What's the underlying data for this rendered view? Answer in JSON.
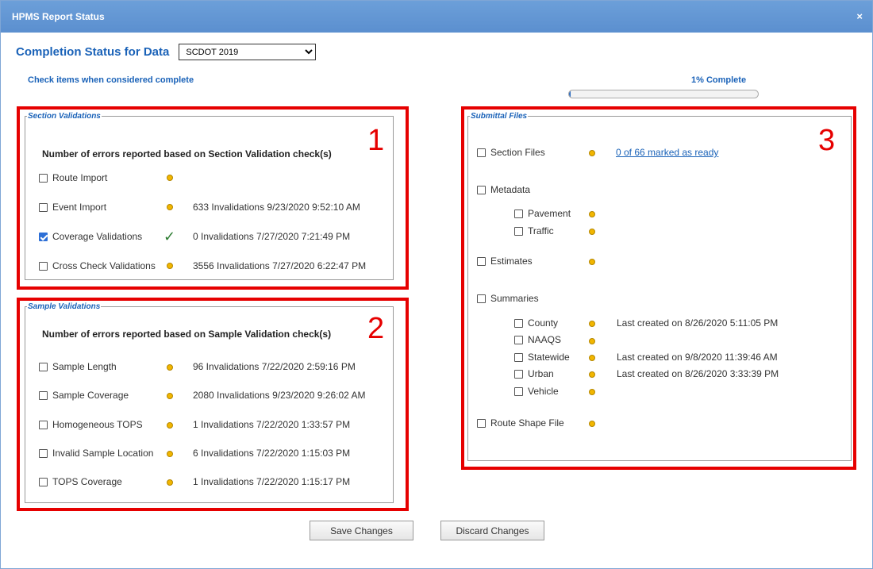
{
  "window": {
    "title": "HPMS Report Status",
    "close_glyph": "×"
  },
  "header": {
    "label": "Completion Status for Data",
    "selected": "SCDOT 2019",
    "hint": "Check items when considered complete",
    "percent_label": "1% Complete",
    "progress": 0.01
  },
  "section": {
    "legend": "Section Validations",
    "number": "1",
    "subhead": "Number of errors reported based on Section Validation check(s)",
    "items": [
      {
        "label": "Route Import",
        "checked": false,
        "indicator": "dot",
        "status": ""
      },
      {
        "label": "Event Import",
        "checked": false,
        "indicator": "dot",
        "status": "633 Invalidations 9/23/2020 9:52:10 AM"
      },
      {
        "label": "Coverage Validations",
        "checked": true,
        "indicator": "check",
        "status": "0 Invalidations 7/27/2020 7:21:49 PM"
      },
      {
        "label": "Cross Check Validations",
        "checked": false,
        "indicator": "dot",
        "status": "3556 Invalidations 7/27/2020 6:22:47 PM"
      }
    ]
  },
  "sample": {
    "legend": "Sample Validations",
    "number": "2",
    "subhead": "Number of errors reported based on Sample Validation check(s)",
    "items": [
      {
        "label": "Sample Length",
        "status": "96 Invalidations 7/22/2020 2:59:16 PM"
      },
      {
        "label": "Sample Coverage",
        "status": "2080 Invalidations 9/23/2020 9:26:02 AM"
      },
      {
        "label": "Homogeneous TOPS",
        "status": "1 Invalidations 7/22/2020 1:33:57 PM"
      },
      {
        "label": "Invalid Sample Location",
        "status": "6 Invalidations 7/22/2020 1:15:03 PM"
      },
      {
        "label": "TOPS Coverage",
        "status": "1 Invalidations 7/22/2020 1:15:17 PM"
      }
    ]
  },
  "submittal": {
    "legend": "Submittal Files",
    "number": "3",
    "section_files": {
      "label": "Section Files",
      "link": "0 of 66 marked as ready"
    },
    "metadata": {
      "label": "Metadata",
      "children": [
        {
          "label": "Pavement"
        },
        {
          "label": "Traffic"
        }
      ]
    },
    "estimates": {
      "label": "Estimates"
    },
    "summaries": {
      "label": "Summaries",
      "children": [
        {
          "label": "County",
          "status": "Last created on 8/26/2020 5:11:05 PM"
        },
        {
          "label": "NAAQS",
          "status": ""
        },
        {
          "label": "Statewide",
          "status": "Last created on 9/8/2020 11:39:46 AM"
        },
        {
          "label": "Urban",
          "status": "Last created on 8/26/2020 3:33:39 PM"
        },
        {
          "label": "Vehicle",
          "status": ""
        }
      ]
    },
    "route_shape": {
      "label": "Route Shape File"
    }
  },
  "buttons": {
    "save": "Save Changes",
    "discard": "Discard Changes"
  },
  "colors": {
    "accent": "#1a62b8",
    "highlight_box": "#e60000",
    "indicator": "#f2b600",
    "complete": "#2e7d32"
  }
}
